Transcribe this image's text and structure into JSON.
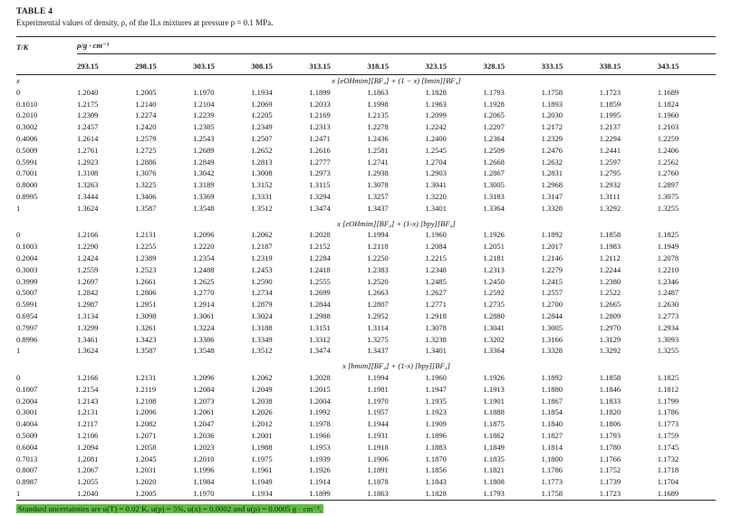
{
  "table": {
    "label": "TABLE 4",
    "caption": "Experimental values of density, ρ, of the ILs mixtures at pressure p = 0.1 MPa.",
    "col1_header": "T/K",
    "unit_header": "ρ/g · cm⁻³",
    "x_column_label": "x",
    "highlight_color": "#5cbe3c",
    "temps": [
      "293.15",
      "298.15",
      "303.15",
      "308.15",
      "313.15",
      "318.15",
      "323.15",
      "328.15",
      "333.15",
      "338.15",
      "343.15"
    ],
    "sections": [
      {
        "title": "x [eOHmim][BF₄] + (1 − x) [bmin][BF₄]",
        "rows": [
          {
            "x": "0",
            "values": [
              "1.2040",
              "1.2005",
              "1.1970",
              "1.1934",
              "1.1899",
              "1.1863",
              "1.1828",
              "1.1793",
              "1.1758",
              "1.1723",
              "1.1689"
            ]
          },
          {
            "x": "0.1010",
            "values": [
              "1.2175",
              "1.2140",
              "1.2104",
              "1.2069",
              "1.2033",
              "1.1998",
              "1.1963",
              "1.1928",
              "1.1893",
              "1.1859",
              "1.1824"
            ]
          },
          {
            "x": "0.2010",
            "values": [
              "1.2309",
              "1.2274",
              "1.2239",
              "1.2205",
              "1.2169",
              "1.2135",
              "1.2099",
              "1.2065",
              "1.2030",
              "1.1995",
              "1.1960"
            ]
          },
          {
            "x": "0.3002",
            "values": [
              "1.2457",
              "1.2420",
              "1.2385",
              "1.2349",
              "1.2313",
              "1.2278",
              "1.2242",
              "1.2207",
              "1.2172",
              "1.2137",
              "1.2103"
            ]
          },
          {
            "x": "0.4006",
            "values": [
              "1.2614",
              "1.2579",
              "1.2543",
              "1.2507",
              "1.2471",
              "1.2436",
              "1.2400",
              "1.2364",
              "1.2329",
              "1.2294",
              "1.2259"
            ]
          },
          {
            "x": "0.5009",
            "values": [
              "1.2761",
              "1.2725",
              "1.2689",
              "1.2652",
              "1.2616",
              "1.2581",
              "1.2545",
              "1.2509",
              "1.2476",
              "1.2441",
              "1.2406"
            ]
          },
          {
            "x": "0.5991",
            "values": [
              "1.2923",
              "1.2886",
              "1.2849",
              "1.2813",
              "1.2777",
              "1.2741",
              "1.2704",
              "1.2668",
              "1.2632",
              "1.2597",
              "1.2562"
            ]
          },
          {
            "x": "0.7001",
            "values": [
              "1.3108",
              "1.3076",
              "1.3042",
              "1.3008",
              "1.2973",
              "1.2938",
              "1.2903",
              "1.2867",
              "1.2831",
              "1.2795",
              "1.2760"
            ]
          },
          {
            "x": "0.8000",
            "values": [
              "1.3263",
              "1.3225",
              "1.3189",
              "1.3152",
              "1.3115",
              "1.3078",
              "1.3041",
              "1.3005",
              "1.2968",
              "1.2932",
              "1.2897"
            ]
          },
          {
            "x": "0.8995",
            "values": [
              "1.3444",
              "1.3406",
              "1.3369",
              "1.3331",
              "1.3294",
              "1.3257",
              "1.3220",
              "1.3183",
              "1.3147",
              "1.3111",
              "1.3075"
            ]
          },
          {
            "x": "1",
            "values": [
              "1.3624",
              "1.3587",
              "1.3548",
              "1.3512",
              "1.3474",
              "1.3437",
              "1.3401",
              "1.3364",
              "1.3328",
              "1.3292",
              "1.3255"
            ]
          }
        ]
      },
      {
        "title": "x [eOHmim][BF₄] + (1-x) [bpy][BF₄]",
        "rows": [
          {
            "x": "0",
            "values": [
              "1.2166",
              "1.2131",
              "1.2096",
              "1.2062",
              "1.2028",
              "1.1994",
              "1.1960",
              "1.1926",
              "1.1892",
              "1.1858",
              "1.1825"
            ]
          },
          {
            "x": "0.1003",
            "values": [
              "1.2290",
              "1.2255",
              "1.2220",
              "1.2187",
              "1.2152",
              "1.2118",
              "1.2084",
              "1.2051",
              "1.2017",
              "1.1983",
              "1.1949"
            ]
          },
          {
            "x": "0.2004",
            "values": [
              "1.2424",
              "1.2389",
              "1.2354",
              "1.2319",
              "1.2284",
              "1.2250",
              "1.2215",
              "1.2181",
              "1.2146",
              "1.2112",
              "1.2078"
            ]
          },
          {
            "x": "0.3003",
            "values": [
              "1.2559",
              "1.2523",
              "1.2488",
              "1.2453",
              "1.2418",
              "1.2383",
              "1.2348",
              "1.2313",
              "1.2279",
              "1.2244",
              "1.2210"
            ]
          },
          {
            "x": "0.3999",
            "values": [
              "1.2697",
              "1.2661",
              "1.2625",
              "1.2590",
              "1.2555",
              "1.2520",
              "1.2485",
              "1.2450",
              "1.2415",
              "1.2380",
              "1.2346"
            ]
          },
          {
            "x": "0.5007",
            "values": [
              "1.2842",
              "1.2806",
              "1.2770",
              "1.2734",
              "1.2699",
              "1.2663",
              "1.2627",
              "1.2592",
              "1.2557",
              "1.2522",
              "1.2487"
            ]
          },
          {
            "x": "0.5991",
            "values": [
              "1.2987",
              "1.2951",
              "1.2914",
              "1.2879",
              "1.2844",
              "1.2807",
              "1.2771",
              "1.2735",
              "1.2700",
              "1.2665",
              "1.2630"
            ]
          },
          {
            "x": "0.6954",
            "values": [
              "1.3134",
              "1.3098",
              "1.3061",
              "1.3024",
              "1.2988",
              "1.2952",
              "1.2918",
              "1.2880",
              "1.2844",
              "1.2809",
              "1.2773"
            ]
          },
          {
            "x": "0.7997",
            "values": [
              "1.3299",
              "1.3261",
              "1.3224",
              "1.3188",
              "1.3151",
              "1.3114",
              "1.3078",
              "1.3041",
              "1.3005",
              "1.2970",
              "1.2934"
            ]
          },
          {
            "x": "0.8996",
            "values": [
              "1.3461",
              "1.3423",
              "1.3386",
              "1.3349",
              "1.3312",
              "1.3275",
              "1.3238",
              "1.3202",
              "1.3166",
              "1.3129",
              "1.3093"
            ]
          },
          {
            "x": "1",
            "values": [
              "1.3624",
              "1.3587",
              "1.3548",
              "1.3512",
              "1.3474",
              "1.3437",
              "1.3401",
              "1.3364",
              "1.3328",
              "1.3292",
              "1.3255"
            ]
          }
        ]
      },
      {
        "title": "x [bmim][BF₄] + (1-x) [bpy][BF₄]",
        "rows": [
          {
            "x": "0",
            "values": [
              "1.2166",
              "1.2131",
              "1.2096",
              "1.2062",
              "1.2028",
              "1.1994",
              "1.1960",
              "1.1926",
              "1.1892",
              "1.1858",
              "1.1825"
            ]
          },
          {
            "x": "0.1007",
            "values": [
              "1.2154",
              "1.2119",
              "1.2084",
              "1.2049",
              "1.2015",
              "1.1981",
              "1.1947",
              "1.1913",
              "1.1880",
              "1.1846",
              "1.1812"
            ]
          },
          {
            "x": "0.2004",
            "values": [
              "1.2143",
              "1.2108",
              "1.2073",
              "1.2038",
              "1.2004",
              "1.1970",
              "1.1935",
              "1.1901",
              "1.1867",
              "1.1833",
              "1.1799"
            ]
          },
          {
            "x": "0.3001",
            "values": [
              "1.2131",
              "1.2096",
              "1.2061",
              "1.2026",
              "1.1992",
              "1.1957",
              "1.1923",
              "1.1888",
              "1.1854",
              "1.1820",
              "1.1786"
            ]
          },
          {
            "x": "0.4004",
            "values": [
              "1.2117",
              "1.2082",
              "1.2047",
              "1.2012",
              "1.1978",
              "1.1944",
              "1.1909",
              "1.1875",
              "1.1840",
              "1.1806",
              "1.1773"
            ]
          },
          {
            "x": "0.5009",
            "values": [
              "1.2106",
              "1.2071",
              "1.2036",
              "1.2001",
              "1.1966",
              "1.1931",
              "1.1896",
              "1.1862",
              "1.1827",
              "1.1793",
              "1.1759"
            ]
          },
          {
            "x": "0.6004",
            "values": [
              "1.2094",
              "1.2058",
              "1.2023",
              "1.1988",
              "1.1953",
              "1.1918",
              "1.1883",
              "1.1849",
              "1.1814",
              "1.1780",
              "1.1745"
            ]
          },
          {
            "x": "0.7013",
            "values": [
              "1.2081",
              "1.2045",
              "1.2010",
              "1.1975",
              "1.1939",
              "1.1906",
              "1.1870",
              "1.1835",
              "1.1800",
              "1.1766",
              "1.1732"
            ]
          },
          {
            "x": "0.8007",
            "values": [
              "1.2067",
              "1.2031",
              "1.1996",
              "1.1961",
              "1.1926",
              "1.1891",
              "1.1856",
              "1.1821",
              "1.1786",
              "1.1752",
              "1.1718"
            ]
          },
          {
            "x": "0.8987",
            "values": [
              "1.2055",
              "1.2020",
              "1.1984",
              "1.1949",
              "1.1914",
              "1.1878",
              "1.1843",
              "1.1808",
              "1.1773",
              "1.1739",
              "1.1704"
            ]
          },
          {
            "x": "1",
            "values": [
              "1.2040",
              "1.2005",
              "1.1970",
              "1.1934",
              "1.1899",
              "1.1863",
              "1.1828",
              "1.1793",
              "1.1758",
              "1.1723",
              "1.1689"
            ]
          }
        ]
      }
    ],
    "footnote": "Standard uncertainties are u(T) = 0.02 K, u(p) = 5%, u(x) = 0.0002 and u(ρ) = 0.0005 g · cm⁻³."
  }
}
